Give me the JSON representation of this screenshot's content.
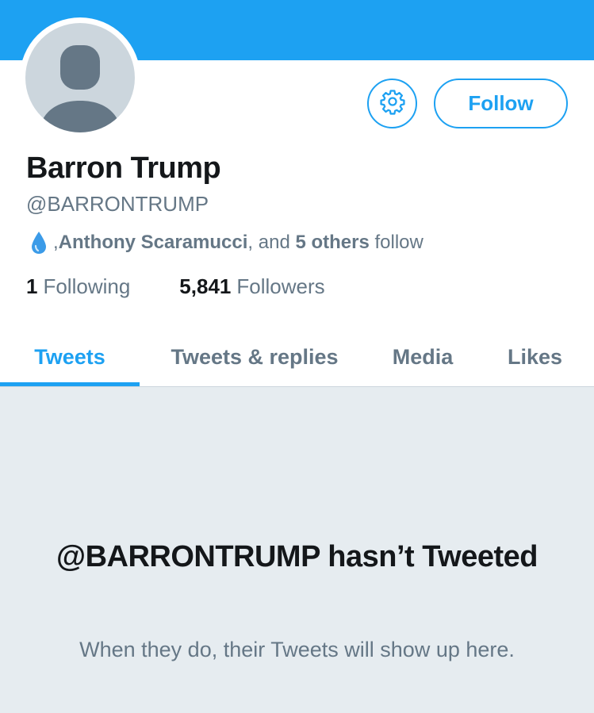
{
  "profile": {
    "name": "Barron Trump",
    "handle": "@BARRONTRUMP",
    "follow_label": "Follow",
    "followed_by": {
      "prefix": ", ",
      "user": "Anthony Scaramucci",
      "middle": ", and ",
      "others": "5 others",
      "suffix": " follow"
    },
    "stats": {
      "following_count": "1",
      "following_label": "Following",
      "followers_count": "5,841",
      "followers_label": "Followers"
    }
  },
  "tabs": [
    {
      "label": "Tweets",
      "active": true
    },
    {
      "label": "Tweets & replies",
      "active": false
    },
    {
      "label": "Media",
      "active": false
    },
    {
      "label": "Likes",
      "active": false
    }
  ],
  "empty_state": {
    "title": "@BARRONTRUMP hasn’t Tweeted",
    "subtitle": "When they do, their Tweets will show up here."
  },
  "colors": {
    "accent": "#1DA1F2",
    "text": "#14171A",
    "muted": "#657786",
    "background_empty": "#E6ECF0",
    "avatar_placeholder": "#CCD6DD"
  },
  "icons": {
    "settings": "gear-icon",
    "droplet": "droplet-emoji-icon"
  }
}
